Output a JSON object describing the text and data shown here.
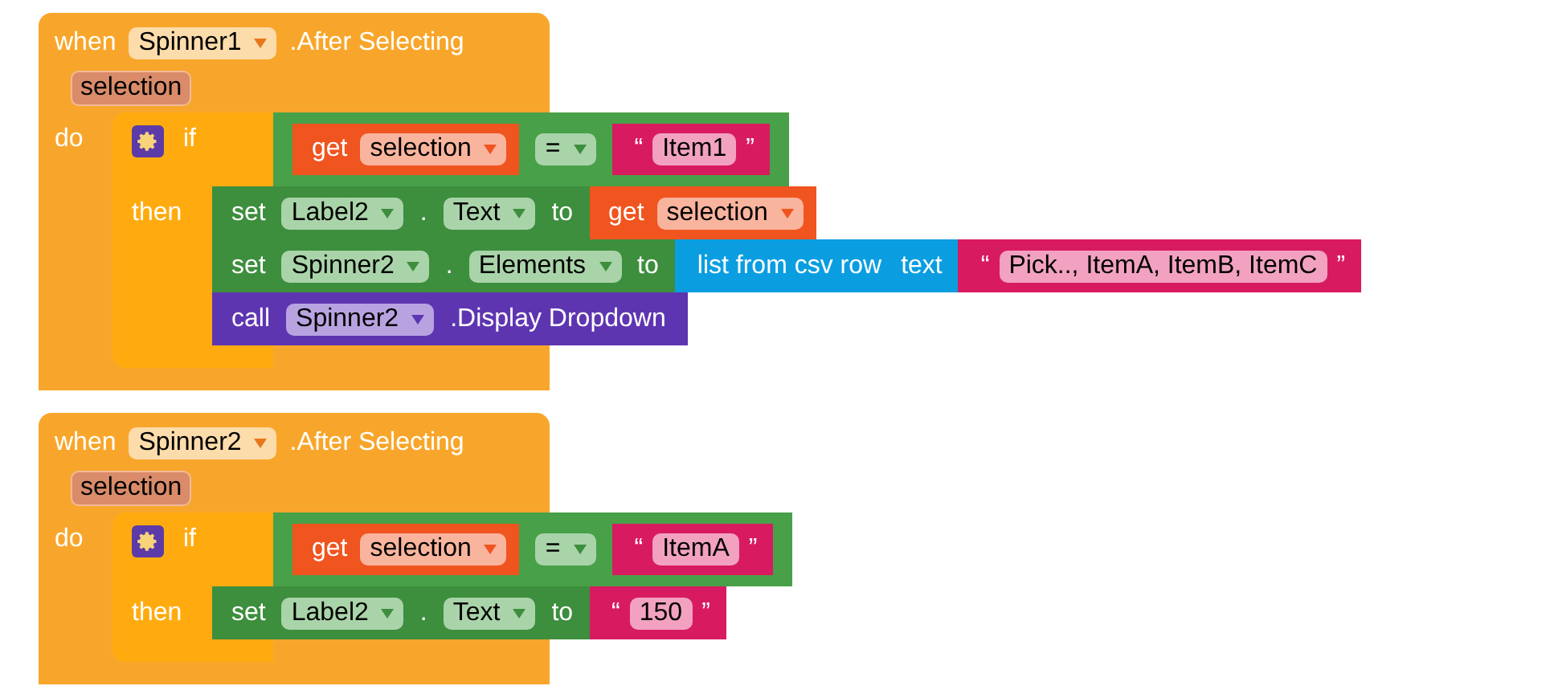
{
  "events": [
    {
      "keyword": "when",
      "component": "Spinner1",
      "event": ".After Selecting",
      "param": "selection",
      "do_label": "do",
      "if": {
        "keyword": "if",
        "then_label": "then",
        "condition": {
          "left": {
            "kind": "get",
            "keyword": "get",
            "variable": "selection"
          },
          "operator": "=",
          "right": {
            "kind": "text",
            "open_quote": "“",
            "value": "Item1",
            "close_quote": "”"
          }
        },
        "statements": [
          {
            "kind": "set",
            "keyword": "set",
            "component": "Label2",
            "dot": ".",
            "property": "Text",
            "to": "to",
            "value": {
              "kind": "get",
              "keyword": "get",
              "variable": "selection"
            }
          },
          {
            "kind": "set",
            "keyword": "set",
            "component": "Spinner2",
            "dot": ".",
            "property": "Elements",
            "to": "to",
            "value": {
              "kind": "csv",
              "label": "list from csv row",
              "param": "text",
              "input": {
                "kind": "text",
                "open_quote": "“",
                "value": "Pick.., ItemA, ItemB, ItemC",
                "close_quote": "”"
              }
            }
          },
          {
            "kind": "call",
            "keyword": "call",
            "component": "Spinner2",
            "method": ".Display Dropdown"
          }
        ]
      }
    },
    {
      "keyword": "when",
      "component": "Spinner2",
      "event": ".After Selecting",
      "param": "selection",
      "do_label": "do",
      "if": {
        "keyword": "if",
        "then_label": "then",
        "condition": {
          "left": {
            "kind": "get",
            "keyword": "get",
            "variable": "selection"
          },
          "operator": "=",
          "right": {
            "kind": "text",
            "open_quote": "“",
            "value": "ItemA",
            "close_quote": "”"
          }
        },
        "statements": [
          {
            "kind": "set",
            "keyword": "set",
            "component": "Label2",
            "dot": ".",
            "property": "Text",
            "to": "to",
            "value": {
              "kind": "text",
              "open_quote": "“",
              "value": "150",
              "close_quote": "”"
            }
          }
        ]
      }
    }
  ]
}
